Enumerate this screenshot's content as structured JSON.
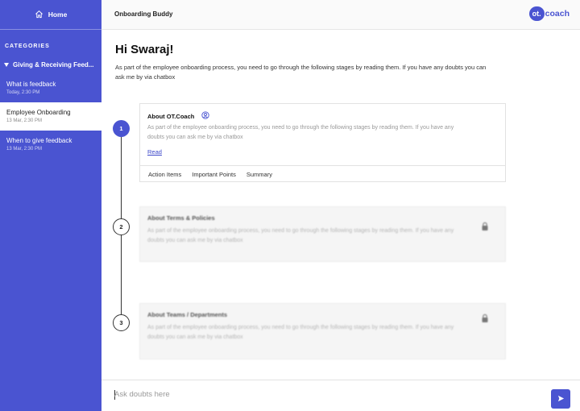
{
  "sidebar": {
    "home_label": "Home",
    "categories_heading": "CATEGORIES",
    "group_label": "Giving & Receiving Feed...",
    "items": [
      {
        "title": "What is  feedback",
        "date": "Today, 2:30 PM",
        "active": false
      },
      {
        "title": "Employee Onboarding",
        "date": "13 Mar, 2:30 PM",
        "active": true
      },
      {
        "title": "When to give feedback",
        "date": "13 Mar, 2:30 PM",
        "active": false
      }
    ]
  },
  "header": {
    "title": "Onboarding Buddy",
    "logo_badge": "ot.",
    "logo_text": "coach"
  },
  "main": {
    "greeting": "Hi Swaraj!",
    "intro": "As part of the employee onboarding process, you need to go through the following stages by reading them. If you have any doubts you can ask me by via chatbox",
    "stages": [
      {
        "number": "1",
        "title": "About OT.Coach",
        "description": "As part of the employee onboarding process, you need to go through the following stages by reading them. If you have any doubts you can ask me by via chatbox",
        "read_label": "Read",
        "tabs": [
          "Action Items",
          "Important Points",
          "Summary"
        ],
        "locked": false
      },
      {
        "number": "2",
        "title": "About Terms & Policies",
        "description": "As part of the employee onboarding process, you need to go through the following stages by reading them. If you have any doubts you can ask me by via chatbox",
        "locked": true
      },
      {
        "number": "3",
        "title": "About Teams / Departments",
        "description": "As part of the employee onboarding process, you need to go through the following stages by reading them. If you have any doubts you can ask me by via chatbox",
        "locked": true
      }
    ]
  },
  "chat": {
    "placeholder": "Ask doubts here"
  },
  "colors": {
    "accent": "#4a54d1",
    "link": "#3b46c9"
  },
  "icons": {
    "home": "home-icon",
    "user": "user-icon",
    "lock": "lock-icon",
    "send": "send-icon"
  }
}
